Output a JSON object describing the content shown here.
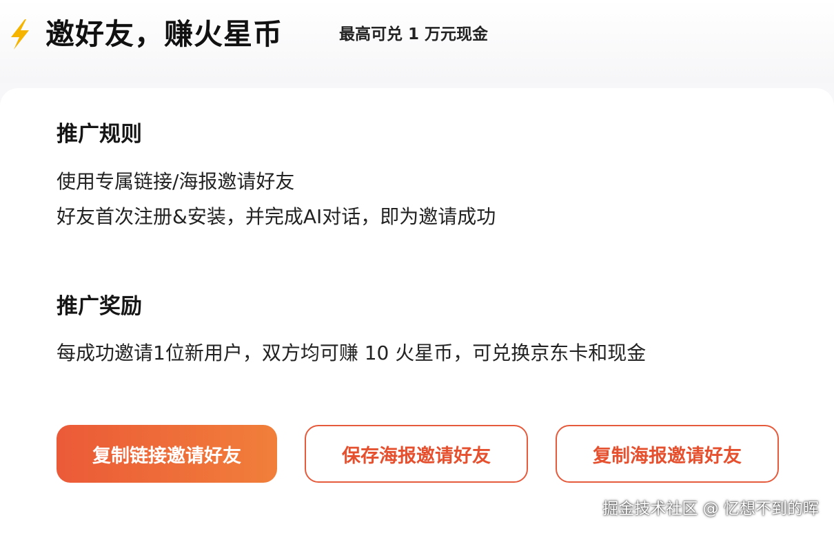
{
  "header": {
    "icon": "lightning-bolt-icon",
    "title": "邀好友，赚火星币",
    "subtitle": "最高可兑 1 万元现金"
  },
  "rules": {
    "title": "推广规则",
    "lines": [
      "使用专属链接/海报邀请好友",
      "好友首次注册&安装，并完成AI对话，即为邀请成功"
    ]
  },
  "rewards": {
    "title": "推广奖励",
    "line": "每成功邀请1位新用户，双方均可赚 10 火星币，可兑换京东卡和现金"
  },
  "actions": {
    "copy_link": "复制链接邀请好友",
    "save_poster": "保存海报邀请好友",
    "copy_poster": "复制海报邀请好友"
  },
  "watermark": "掘金技术社区 @ 忆想不到的晖",
  "colors": {
    "accent": "#eb5a38",
    "accent_end": "#f17f3a",
    "bolt": "#f5b400"
  }
}
